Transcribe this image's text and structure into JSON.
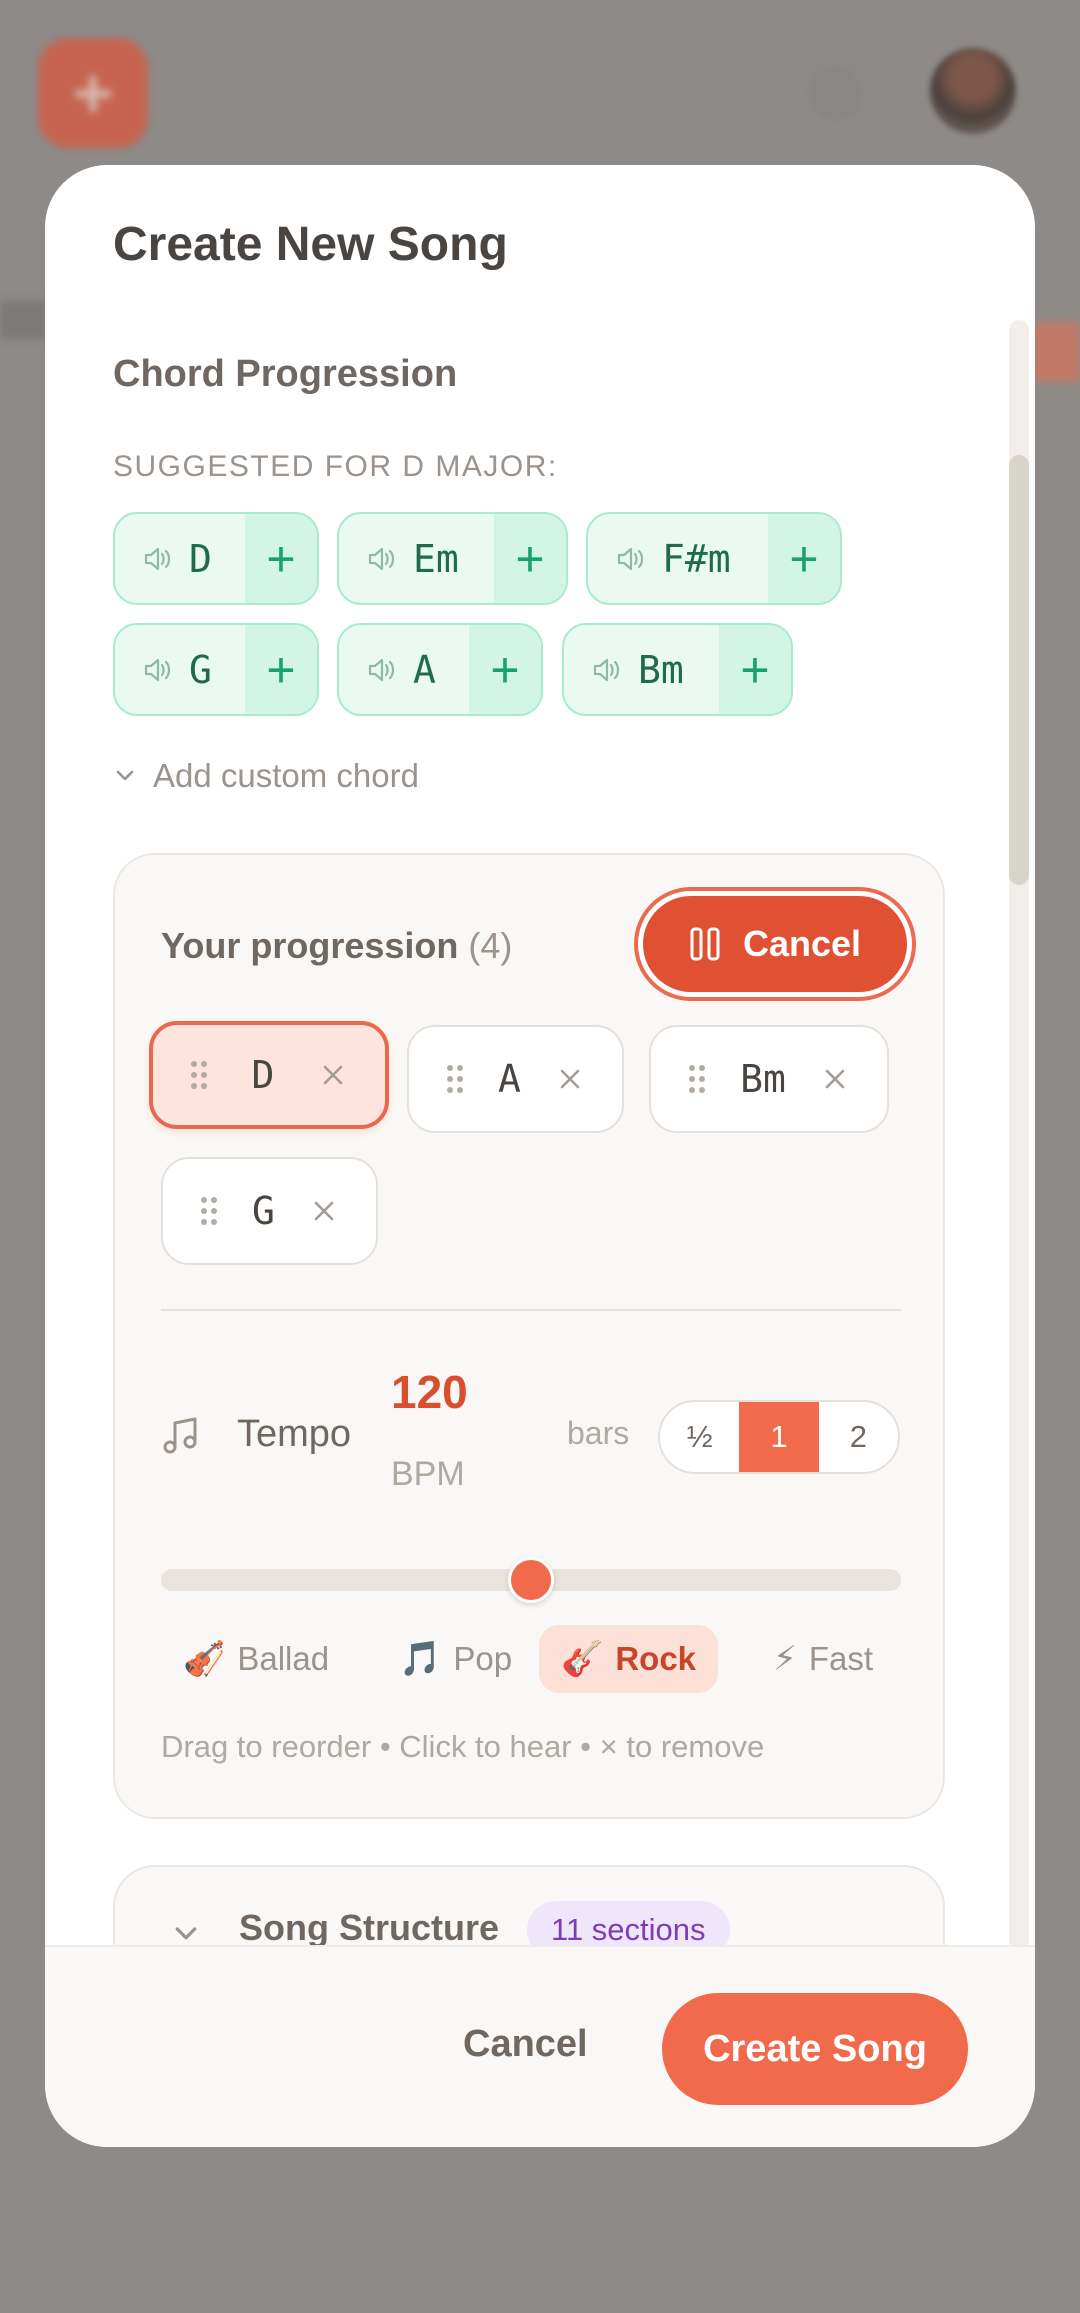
{
  "modal": {
    "title": "Create New Song"
  },
  "chords": {
    "section_title": "Chord Progression",
    "suggested_label": "SUGGESTED FOR D MAJOR:",
    "suggestions": [
      {
        "name": "D"
      },
      {
        "name": "Em"
      },
      {
        "name": "F#m"
      },
      {
        "name": "G"
      },
      {
        "name": "A"
      },
      {
        "name": "Bm"
      }
    ],
    "add_symbol": "+",
    "custom_toggle": "Add custom chord"
  },
  "progression": {
    "title": "Your progression",
    "count": "(4)",
    "cancel_label": "Cancel",
    "items": [
      {
        "name": "D",
        "active": true
      },
      {
        "name": "A",
        "active": false
      },
      {
        "name": "Bm",
        "active": false
      },
      {
        "name": "G",
        "active": false
      }
    ],
    "tempo_label": "Tempo",
    "tempo_value": "120",
    "tempo_unit": "BPM",
    "bars_label": "bars",
    "bars_options": [
      "½",
      "1",
      "2"
    ],
    "bars_selected": "1",
    "tempo_slider_fraction": 0.5,
    "presets": [
      {
        "emoji": "🎻",
        "label": "Ballad",
        "active": false
      },
      {
        "emoji": "🎵",
        "label": "Pop",
        "active": false
      },
      {
        "emoji": "🎸",
        "label": "Rock",
        "active": true
      },
      {
        "emoji": "⚡",
        "label": "Fast",
        "active": false
      }
    ],
    "hint": "Drag to reorder • Click to hear • × to remove"
  },
  "structure": {
    "title": "Song Structure",
    "badge": "11 sections"
  },
  "footer": {
    "cancel_label": "Cancel",
    "create_label": "Create Song"
  },
  "colors": {
    "accent": "#f06a4b",
    "chip_green_bg": "#eafaf3",
    "chip_green_text": "#1f6b4f",
    "badge_purple": "#7c3db5"
  },
  "icons": {
    "play": "speaker-icon",
    "grip": "drag-handle-icon",
    "remove": "close-icon",
    "pause": "pause-icon",
    "tempo": "music-note-icon",
    "expand": "chevron-down-icon"
  }
}
